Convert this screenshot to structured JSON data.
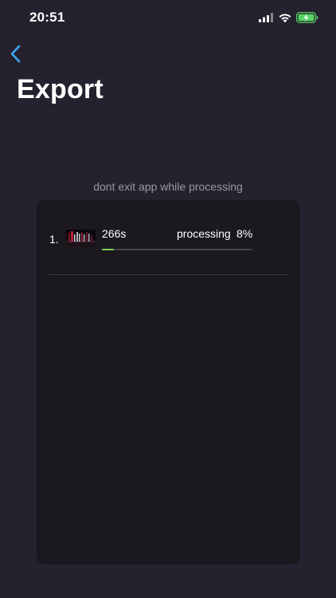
{
  "status_bar": {
    "time": "20:51",
    "icons": [
      "signal-icon",
      "wifi-icon",
      "battery-charging-icon"
    ],
    "battery_color": "#56d364"
  },
  "header": {
    "back_icon": "chevron-left-icon",
    "title": "Export",
    "accent_color": "#3fa8ef"
  },
  "warning": "dont exit app while processing",
  "jobs": [
    {
      "index": "1.",
      "duration": "266s",
      "status": "processing",
      "percent_label": "8%",
      "progress": 0.08,
      "progress_color": "#7dd35a"
    }
  ]
}
